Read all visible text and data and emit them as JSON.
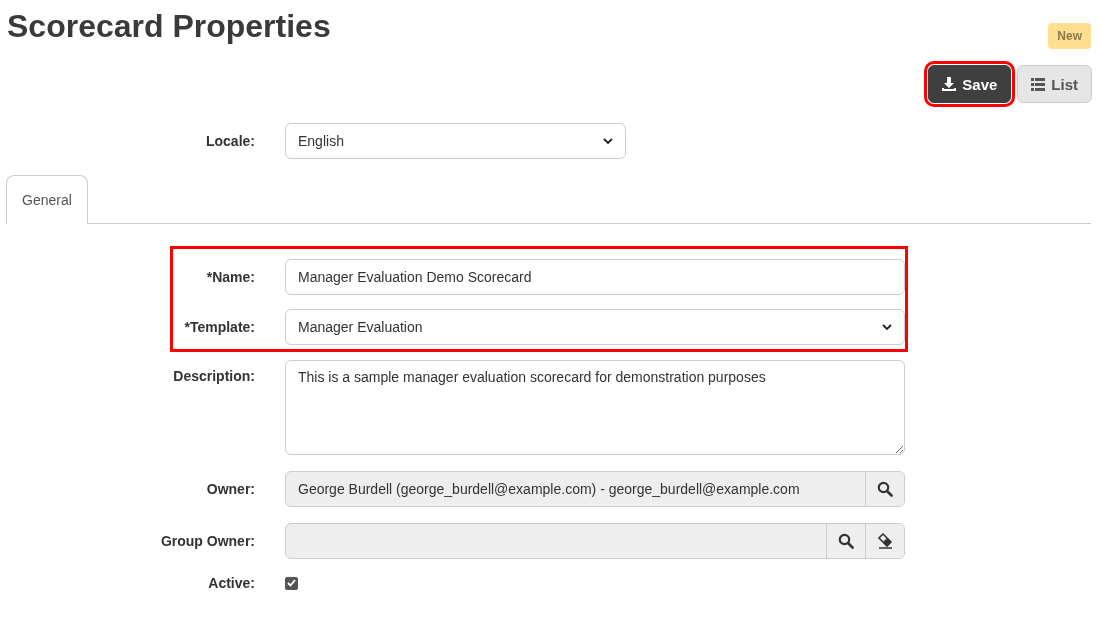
{
  "page": {
    "title": "Scorecard Properties",
    "badge": "New"
  },
  "toolbar": [
    {
      "kind": "save",
      "label": "Save",
      "highlighted": true
    },
    {
      "kind": "list",
      "label": "List",
      "highlighted": false
    }
  ],
  "locale": {
    "label": "Locale:",
    "value": "English"
  },
  "tabs": [
    {
      "label": "General",
      "selected": true
    }
  ],
  "fields": [
    {
      "kind": "text",
      "label": "*Name:",
      "value": "Manager Evaluation Demo Scorecard",
      "highlighted": true
    },
    {
      "kind": "select",
      "label": "*Template:",
      "value": "Manager Evaluation",
      "highlighted": true
    },
    {
      "kind": "textarea",
      "label": "Description:",
      "value": "This is a sample manager evaluation scorecard for demonstration purposes",
      "highlighted": false
    },
    {
      "kind": "lookup",
      "label": "Owner:",
      "value": "George Burdell (george_burdell@example.com) - george_burdell@example.com",
      "actions": [
        {
          "kind": "search"
        }
      ],
      "highlighted": false
    },
    {
      "kind": "lookup",
      "label": "Group Owner:",
      "actions": [
        {
          "kind": "search"
        },
        {
          "kind": "clear"
        }
      ],
      "highlighted": false
    },
    {
      "kind": "checkbox",
      "label": "Active:",
      "checked": true,
      "highlighted": false
    }
  ]
}
